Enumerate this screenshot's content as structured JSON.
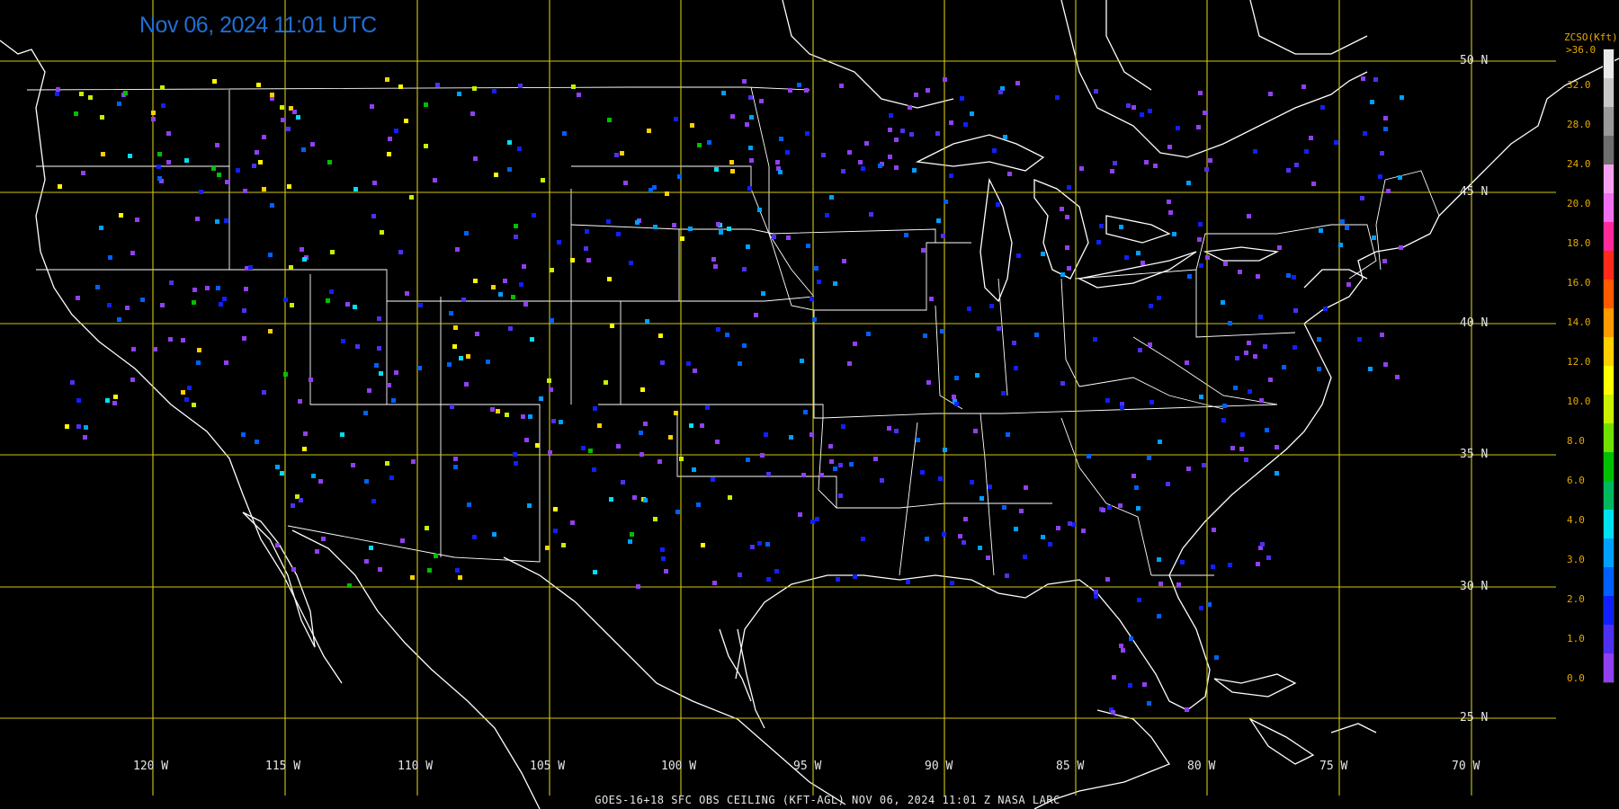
{
  "timestamp": "Nov 06, 2024 11:01 UTC",
  "footer": "GOES-16+18  SFC OBS CEILING (KFT-AGL)   NOV 06, 2024 11:01 Z   NASA LARC",
  "legend": {
    "title": "ZCSO(Kft)",
    "top_label": ">36.0",
    "levels": [
      "32.0",
      "28.0",
      "24.0",
      "20.0",
      "18.0",
      "16.0",
      "14.0",
      "12.0",
      "10.0",
      "8.0",
      "6.0",
      "4.0",
      "3.0",
      "2.0",
      "1.0",
      "0.0"
    ],
    "colors": [
      "#e8e8e8",
      "#c8c8c8",
      "#9a9a9a",
      "#6e6e6e",
      "#f5a0f0",
      "#f070f0",
      "#ff2a9a",
      "#ff2a1a",
      "#ff5a00",
      "#ff9a00",
      "#ffd000",
      "#ffff00",
      "#c8f000",
      "#70e000",
      "#00c000",
      "#00b860",
      "#00e0f0",
      "#00a0ff",
      "#0060ff",
      "#1020ff",
      "#5030f0",
      "#9040f0"
    ]
  },
  "lat_labels": [
    "50 N",
    "45 N",
    "40 N",
    "35 N",
    "30 N",
    "25 N"
  ],
  "lon_labels": [
    "120 W",
    "115 W",
    "110 W",
    "105 W",
    "100 W",
    "95 W",
    "90 W",
    "85 W",
    "80 W",
    "75 W",
    "70 W"
  ],
  "colors": {
    "grid": "#d2c814",
    "coast": "#ffffff",
    "background": "#000000",
    "timestamp": "#1f6fd6",
    "legend_text": "#e6a800"
  }
}
